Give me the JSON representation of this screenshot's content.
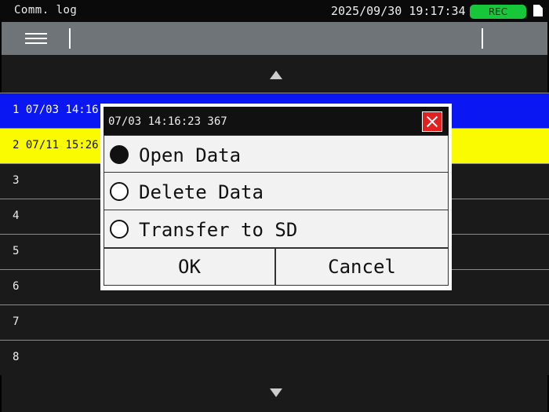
{
  "status": {
    "title": "Comm. log",
    "datetime": "2025/09/30 19:17:34",
    "rec_label": "REC",
    "rec_color": "#16c73a"
  },
  "toolbar": {
    "menu_icon": "hamburger-menu-icon"
  },
  "list": {
    "rows": [
      {
        "label": "1 07/03 14:16",
        "state": "selected-blue"
      },
      {
        "label": "2 07/11 15:26",
        "state": "selected-yellow"
      },
      {
        "label": "3"
      },
      {
        "label": "4"
      },
      {
        "label": "5"
      },
      {
        "label": "6"
      },
      {
        "label": "7"
      },
      {
        "label": "8"
      }
    ]
  },
  "dialog": {
    "title": "07/03 14:16:23 367",
    "options": [
      {
        "label": "Open Data",
        "selected": true
      },
      {
        "label": "Delete Data",
        "selected": false
      },
      {
        "label": "Transfer to SD",
        "selected": false
      }
    ],
    "ok_label": "OK",
    "cancel_label": "Cancel"
  },
  "colors": {
    "selected_blue": "#0b17f2",
    "selected_yellow": "#fafa00",
    "close_red": "#e32020"
  }
}
